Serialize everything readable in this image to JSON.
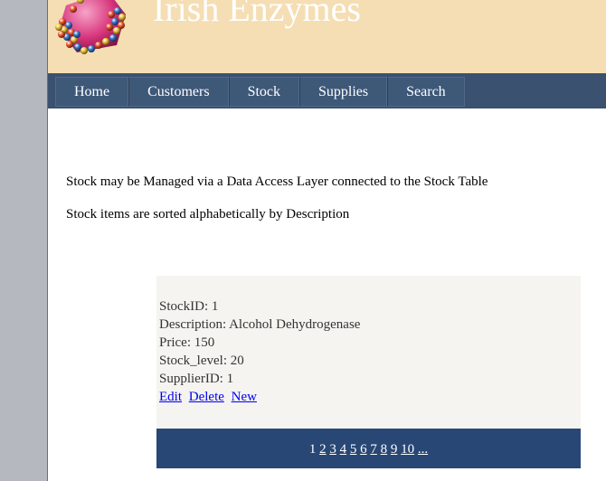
{
  "site": {
    "title": "Irish Enzymes",
    "logo_icon": "molecule-cluster-icon"
  },
  "nav": {
    "items": [
      {
        "label": "Home"
      },
      {
        "label": "Customers"
      },
      {
        "label": "Stock"
      },
      {
        "label": "Supplies"
      },
      {
        "label": "Search"
      }
    ]
  },
  "main": {
    "intro": "Stock may be Managed via a Data Access Layer connected to the Stock Table",
    "sort_note": "Stock items are sorted alphabetically by Description"
  },
  "record": {
    "stock_id": "StockID: 1",
    "description": "Description: Alcohol Dehydrogenase",
    "price": "Price: 150",
    "stock_level": "Stock_level: 20",
    "supplier_id": "SupplierID: 1",
    "edit_label": "Edit",
    "delete_label": "Delete",
    "new_label": "New"
  },
  "pager": {
    "current": "1",
    "pages": [
      "2",
      "3",
      "4",
      "5",
      "6",
      "7",
      "8",
      "9",
      "10"
    ],
    "more": "..."
  },
  "colors": {
    "header_bg": "#f5deb3",
    "nav_bg": "#3b5170",
    "pager_bg": "#284775",
    "panel_bg": "#f5f4f0",
    "link": "#0000ee"
  }
}
